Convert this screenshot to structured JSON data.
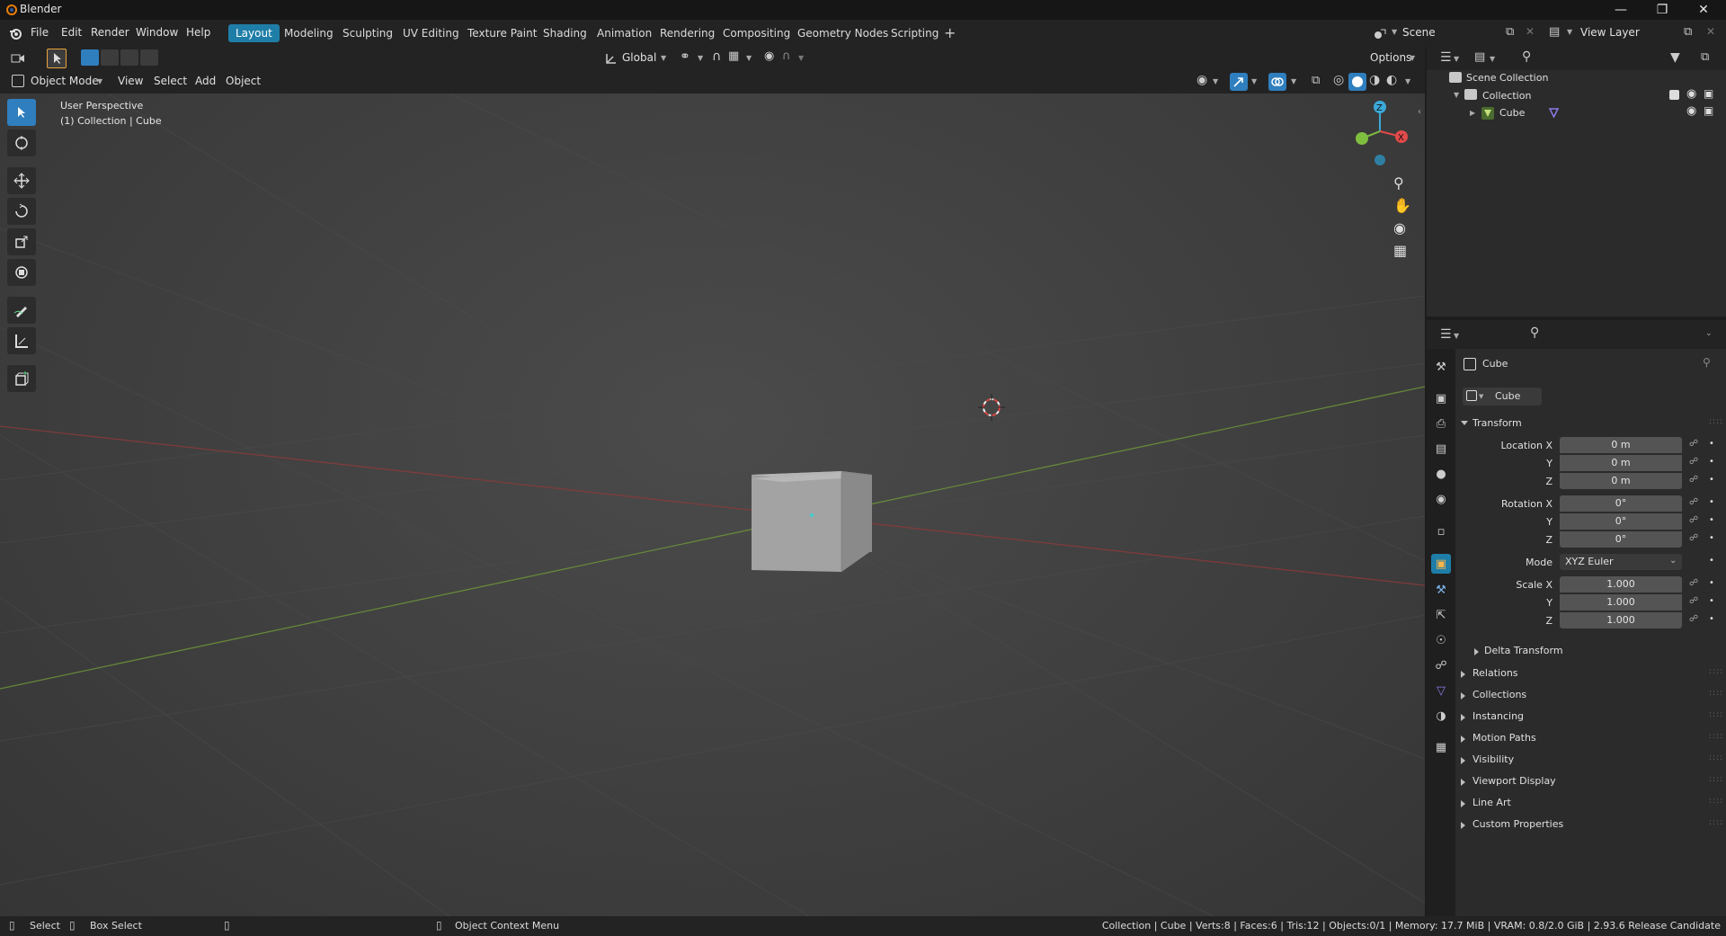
{
  "window": {
    "title": "Blender"
  },
  "menu": {
    "file": "File",
    "edit": "Edit",
    "render": "Render",
    "window": "Window",
    "help": "Help"
  },
  "workspaces": [
    "Layout",
    "Modeling",
    "Sculpting",
    "UV Editing",
    "Texture Paint",
    "Shading",
    "Animation",
    "Rendering",
    "Compositing",
    "Geometry Nodes",
    "Scripting"
  ],
  "active_workspace": "Layout",
  "scene": {
    "name": "Scene",
    "view_layer": "View Layer"
  },
  "toolheader": {
    "orientation": "Global",
    "options": "Options"
  },
  "viewheader": {
    "mode": "Object Mode",
    "view": "View",
    "select": "Select",
    "add": "Add",
    "object": "Object"
  },
  "viewport": {
    "perspective": "User Perspective",
    "context": "(1) Collection | Cube"
  },
  "gizmo": {
    "z": "Z",
    "x": "X"
  },
  "outliner": {
    "root": "Scene Collection",
    "collection": "Collection",
    "object": "Cube"
  },
  "properties": {
    "object_name": "Cube",
    "data_name": "Cube",
    "transform_title": "Transform",
    "location": {
      "label": "Location X",
      "x": "0 m",
      "y": "0 m",
      "z": "0 m"
    },
    "rotation": {
      "label": "Rotation X",
      "x": "0°",
      "y": "0°",
      "z": "0°"
    },
    "mode": {
      "label": "Mode",
      "value": "XYZ Euler"
    },
    "scale": {
      "label": "Scale X",
      "x": "1.000",
      "y": "1.000",
      "z": "1.000"
    },
    "axis_y": "Y",
    "axis_z": "Z",
    "delta": "Delta Transform",
    "panels": [
      "Relations",
      "Collections",
      "Instancing",
      "Motion Paths",
      "Visibility",
      "Viewport Display",
      "Line Art",
      "Custom Properties"
    ]
  },
  "statusbar": {
    "select": "Select",
    "box_select": "Box Select",
    "context_menu": "Object Context Menu",
    "info": "Collection | Cube | Verts:8 | Faces:6 | Tris:12 | Objects:0/1 | Memory: 17.7 MiB | VRAM: 0.8/2.0 GiB | 2.93.6 Release Candidate"
  },
  "colors": {
    "accent": "#1f7ea8",
    "x_axis": "#e24a4a",
    "y_axis": "#7fbf3f",
    "z_axis": "#3ba9d9"
  }
}
